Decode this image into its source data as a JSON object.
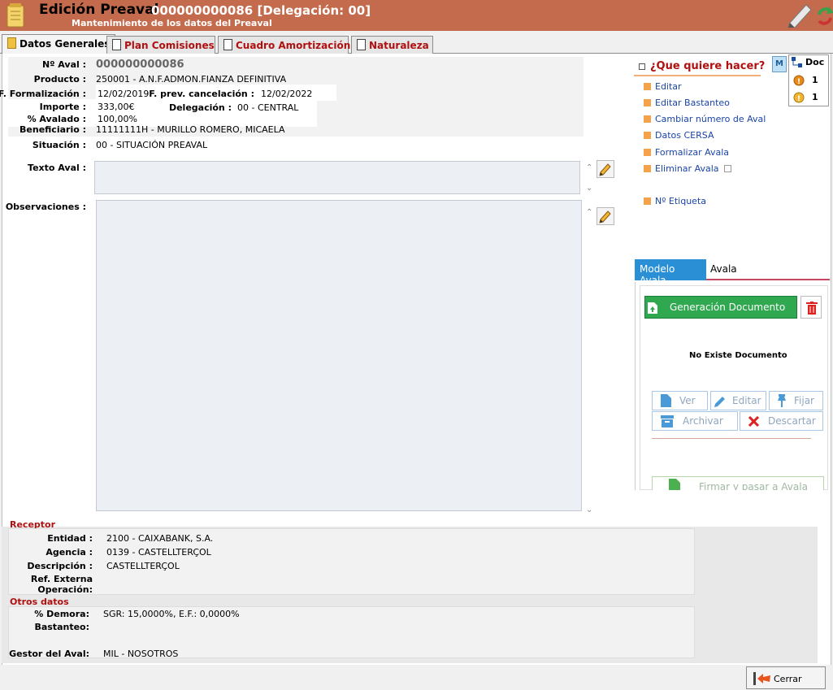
{
  "header": {
    "title": "Edición Preaval",
    "code": "000000000086 [Delegación: 00]",
    "subtitle": "Mantenimiento de los datos del Preaval",
    "color": "#c56b4d"
  },
  "tabs": [
    {
      "label": "Datos Generales",
      "active": true
    },
    {
      "label": "Plan Comisiones",
      "active": false
    },
    {
      "label": "Cuadro Amortización",
      "active": false
    },
    {
      "label": "Naturaleza",
      "active": false
    }
  ],
  "general": {
    "aval_label": "Nº Aval :",
    "aval_value": "000000000086",
    "producto_label": "Producto :",
    "producto_value": "250001 - A.N.F.ADMON.FIANZA DEFINITIVA",
    "f_formalizacion_label": "F. Formalización :",
    "f_formalizacion_value": "12/02/2019",
    "f_prev_cancelacion_label": "F. prev. cancelación :",
    "f_prev_cancelacion_value": "12/02/2022",
    "importe_label": "Importe :",
    "importe_value": "333,00€",
    "delegacion_label": "Delegación :",
    "delegacion_value": "00 - CENTRAL",
    "avalado_label": "% Avalado :",
    "avalado_value": "100,00%",
    "beneficiario_label": "Beneficiario :",
    "beneficiario_value": "11111111H - MURILLO ROMERO, MICAELA",
    "situacion_label": "Situación :",
    "situacion_value": "00 - SITUACIÓN PREAVAL",
    "texto_aval_label": "Texto Aval :",
    "observaciones_label": "Observaciones :"
  },
  "actions": {
    "title": "¿Que quiere hacer?",
    "items": [
      "Editar",
      "Editar Bastanteo",
      "Cambiar número de Aval",
      "Datos CERSA",
      "Formalizar Avala",
      "Eliminar Avala",
      "Nº Etiqueta"
    ]
  },
  "doc_panel": {
    "m_label": "M",
    "title": "Doc",
    "count_1": "1",
    "count_2": "1"
  },
  "modelo": {
    "tab_modelo": "Modelo Avala",
    "tab_avala": "Avala",
    "generate_label": "Generación Documento",
    "no_doc": "No Existe Documento",
    "ver": "Ver",
    "editar": "Editar",
    "fijar": "Fijar",
    "archivar": "Archivar",
    "descartar": "Descartar",
    "firmar": "Firmar y pasar a Avala"
  },
  "receptor": {
    "section": "Receptor",
    "entidad_label": "Entidad :",
    "entidad_value": "2100 - CAIXABANK, S.A.",
    "agencia_label": "Agencia :",
    "agencia_value": "0139 - CASTELLTERÇOL",
    "descripcion_label": "Descripción :",
    "descripcion_value": "CASTELLTERÇOL",
    "ref_label_1": "Ref. Externa",
    "ref_label_2": "Operación:"
  },
  "otros": {
    "section": "Otros datos",
    "demora_label": "% Demora:",
    "demora_value": "SGR: 15,0000%, E.F.: 0,0000%",
    "bastanteo_label": "Bastanteo:",
    "gestor_label": "Gestor del Aval:",
    "gestor_value": "MIL - NOSOTROS"
  },
  "footer": {
    "close_label": "Cerrar"
  }
}
